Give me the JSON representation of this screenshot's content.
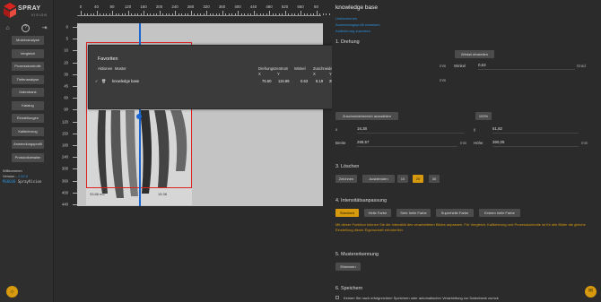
{
  "brand": {
    "name": "SPRAY",
    "sub": "VISION",
    "logo_color": "#d7221e"
  },
  "sidebar": {
    "icons": [
      {
        "name": "home-icon"
      },
      {
        "name": "help-circle-icon"
      },
      {
        "name": "logout-icon"
      }
    ],
    "items": [
      {
        "label": "Musteranalyse"
      },
      {
        "label": "Vergleich"
      },
      {
        "label": "Prozesskontrolle"
      },
      {
        "label": "Tiefenanalyse"
      },
      {
        "label": "Datenbank"
      },
      {
        "label": "Katalog"
      },
      {
        "label": "Einstellungen"
      },
      {
        "label": "Kalibrierung"
      },
      {
        "label": "Anwendungsprofil"
      },
      {
        "label": "Protokolldetailer"
      }
    ],
    "welcome": "Willkommen",
    "version_label": "Version - ",
    "version": "1.52.5",
    "user_id": "MS8030",
    "user_name": "SprayVision"
  },
  "ruler": {
    "top_ticks": [
      "0",
      "40",
      "80",
      "120",
      "160",
      "200",
      "240",
      "280",
      "320",
      "360",
      "400",
      "440",
      "480",
      "520",
      "560",
      "60"
    ],
    "left_ticks": [
      "0",
      "5",
      "10",
      "20",
      "30",
      "45",
      "60",
      "90",
      "120",
      "150",
      "180",
      "240",
      "300",
      "360",
      "400",
      "440"
    ]
  },
  "canvas": {
    "dim_bottom": "33.86 m2",
    "dim_left": "77.48 mm",
    "dim_right": "67.51 mm",
    "dim_top": "15.38"
  },
  "modal": {
    "title": "Favoriten",
    "headers": {
      "actions": "Aktionen",
      "pattern": "Muster",
      "rotation": "Drehungszentrum",
      "rotation_x": "X",
      "rotation_y": "Y",
      "angle": "Winkel",
      "crop": "Zuschneiden",
      "crop_x": "X",
      "crop_y": "Y",
      "width": "Breite",
      "height": "Höhe"
    },
    "row": {
      "check": "✔",
      "delete": "🗑",
      "pattern": "knowledge base",
      "rot_x": "75.50",
      "rot_y": "115.89",
      "angle": "0.63",
      "crop_x": "8.19",
      "crop_y": "25.91",
      "width": "134.88",
      "height": "180.02",
      "profile": "Standard"
    },
    "cancel_label": "Abbrechen"
  },
  "panel": {
    "title": "knowledge base",
    "links": [
      "Umbenennen",
      "Anwendungsprofil zuweisen",
      "Kalibrierung zuweisen"
    ],
    "sections": {
      "rotation": "1. Drehung",
      "delete": "3. Löschen",
      "intensity": "4. Intensitätsanpassung",
      "recognition": "5. Mustererkennung",
      "save": "6. Speichern"
    },
    "rotation": {
      "set_angle_label": "Winkel einstellen",
      "angle_label": "Winkel",
      "angle_value": "0,63",
      "angle_unit": "Grad",
      "mm1": "mm",
      "mm2": "mm"
    },
    "crop": {
      "select_area_label": "Zuschneidebereich auswählen",
      "zoom": "100%",
      "x_label": "x",
      "x_value": "16,38",
      "y_label": "y",
      "y_value": "51,82",
      "width_label": "Breite",
      "width_value": "269,57",
      "height_label": "Höhe",
      "height_value": "360,05",
      "unit": "mm"
    },
    "delete": {
      "draw": "Zeichnen",
      "hide": "Ausblenden",
      "sizes": [
        "10",
        "20",
        "30"
      ],
      "active_size": "20"
    },
    "intensity": {
      "buttons": [
        "Standard",
        "Helle Farbe",
        "Sehr helle Farbe",
        "Superhelle Farbe",
        "Extrem helle Farbe"
      ],
      "active": "Standard",
      "info": "Mit dieser Funktion können Sie die Intensität des verarbeiteten Bildes anpassen. Für Vergleich, Kalibrierung und Prozesskontrolle ist für alle Bilder die gleiche Einstellung dieser Eigenschaft erforderlich."
    },
    "recognition": {
      "button": "Erkennen"
    },
    "save": {
      "label": "Keinen Sie nach erfolgreichem Speichern oder automatischer Verarbeitung zur Datenbank zurück"
    }
  },
  "colors": {
    "accent": "#d79a0f",
    "link": "#2b8fd9",
    "selection": "#d22",
    "guide": "#1a66d1"
  }
}
